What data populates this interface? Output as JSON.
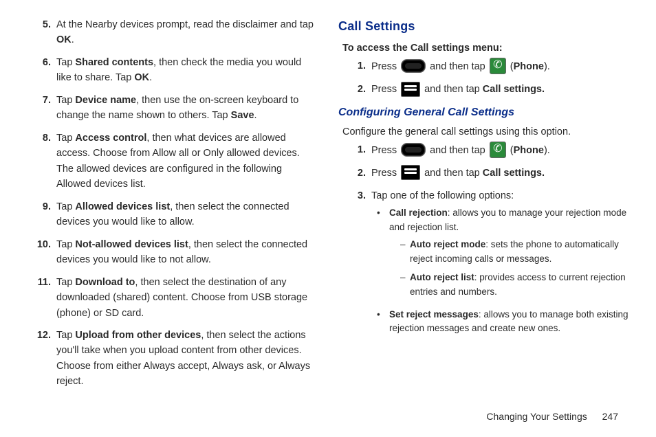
{
  "left": {
    "steps": [
      {
        "n": "5.",
        "pre": "At the Nearby devices prompt, read the disclaimer and tap ",
        "b1": "OK",
        "post": "."
      },
      {
        "n": "6.",
        "pre": "Tap ",
        "b1": "Shared contents",
        "mid": ", then check the media you would like to share. Tap ",
        "b2": "OK",
        "post": "."
      },
      {
        "n": "7.",
        "pre": "Tap ",
        "b1": "Device name",
        "mid": ", then use the on-screen keyboard to change the name shown to others. Tap ",
        "b2": "Save",
        "post": "."
      },
      {
        "n": "8.",
        "pre": "Tap ",
        "b1": "Access control",
        "mid": ", then what devices are allowed access. Choose from Allow all or Only allowed devices. The allowed devices are configured in the following Allowed devices list.",
        "post": ""
      },
      {
        "n": "9.",
        "pre": "Tap ",
        "b1": "Allowed devices list",
        "mid": ", then select the connected devices you would like to allow.",
        "post": ""
      },
      {
        "n": "10.",
        "pre": "Tap ",
        "b1": "Not-allowed devices list",
        "mid": ", then select the connected devices you would like to not allow.",
        "post": ""
      },
      {
        "n": "11.",
        "pre": "Tap ",
        "b1": "Download to",
        "mid": ", then select the destination of any downloaded (shared) content. Choose from USB storage (phone) or SD card.",
        "post": ""
      },
      {
        "n": "12.",
        "pre": "Tap ",
        "b1": "Upload from other devices",
        "mid": ", then select the actions you'll take when you upload content from other devices. Choose from either Always accept, Always ask, or Always reject.",
        "post": ""
      }
    ]
  },
  "right": {
    "heading": "Call Settings",
    "intro_bold": "To access the Call settings menu:",
    "access_steps": {
      "s1": {
        "n": "1.",
        "press": "Press ",
        "andtap": " and then tap ",
        "paren_o": " (",
        "phone": "Phone",
        "paren_c": ")."
      },
      "s2": {
        "n": "2.",
        "press": "Press ",
        "andtap": " and then tap ",
        "cs": "Call settings."
      }
    },
    "sub_heading": "Configuring General Call Settings",
    "sub_intro": "Configure the general call settings using this option.",
    "config_steps": {
      "s1": {
        "n": "1.",
        "press": "Press ",
        "andtap": " and then tap ",
        "paren_o": " (",
        "phone": "Phone",
        "paren_c": ")."
      },
      "s2": {
        "n": "2.",
        "press": "Press ",
        "andtap": " and then tap ",
        "cs": "Call settings."
      },
      "s3": {
        "n": "3.",
        "text": "Tap one of the following options:"
      }
    },
    "bullets": {
      "b1": {
        "bold": "Call rejection",
        "rest": ": allows you to manage your rejection mode and rejection list."
      },
      "b1s1": {
        "bold": "Auto reject mode",
        "rest": ": sets the phone to automatically reject incoming calls or messages."
      },
      "b1s2": {
        "bold": "Auto reject list",
        "rest": ": provides access to current rejection entries and numbers."
      },
      "b2": {
        "bold": "Set reject messages",
        "rest": ": allows you to manage both existing rejection messages and create new ones."
      }
    }
  },
  "footer": {
    "chapter": "Changing Your Settings",
    "page": "247"
  }
}
